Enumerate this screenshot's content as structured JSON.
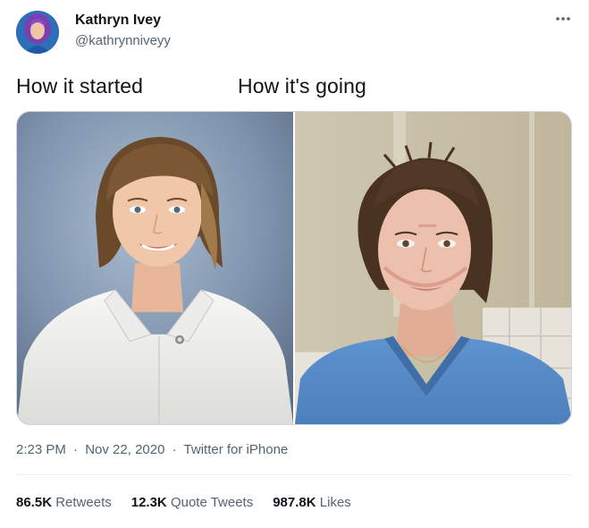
{
  "author": {
    "display_name": "Kathryn Ivey",
    "handle": "@kathrynniveyy",
    "avatar_icon": "profile-photo"
  },
  "more_icon": "more-horizontal-icon",
  "captions": {
    "left": "How it started",
    "right": "How it's going"
  },
  "media": {
    "left_photo": "portrait-white-uniform",
    "right_photo": "portrait-blue-scrubs"
  },
  "meta": {
    "time": "2:23 PM",
    "separator": "·",
    "date": "Nov 22, 2020",
    "source": "Twitter for iPhone"
  },
  "stats": [
    {
      "count": "86.5K",
      "label": "Retweets"
    },
    {
      "count": "12.3K",
      "label": "Quote Tweets"
    },
    {
      "count": "987.8K",
      "label": "Likes"
    }
  ],
  "colors": {
    "text_primary": "#0f1419",
    "text_secondary": "#536471",
    "border": "#eff3f4"
  }
}
